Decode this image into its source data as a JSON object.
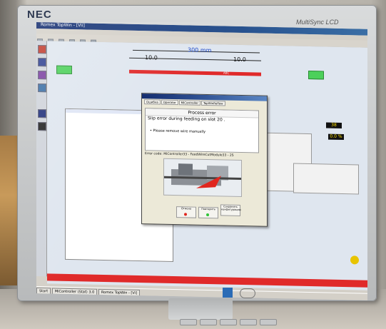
{
  "monitor": {
    "brand": "NEC",
    "model": "MultiSync LCD"
  },
  "app": {
    "title": "Romex TopWin - [Vii]"
  },
  "ruler": {
    "left_value": "10.0",
    "center_value": "300 mm",
    "right_value": "10.0",
    "tag": "ABC"
  },
  "dialog": {
    "tabs": [
      "Ошибка",
      "Operator",
      "MIController",
      "TopWinReflow"
    ],
    "header": "Process error",
    "message": "Slip error during feeding on slot 20 .",
    "bullet": "• Please remove wire manually",
    "error_code": "Error code: MiController33 - FeedWireCutModule33 - 25",
    "buttons": [
      "Отмена",
      "Повторить",
      "Сохранить конфигурацию"
    ]
  },
  "gauges": {
    "top": "38",
    "bottom": "0.0 %"
  },
  "taskbar": {
    "start": "Start",
    "items": [
      "MiController (Stat) 3.0",
      "Romex TopWin - [Vi]"
    ]
  },
  "colors": {
    "accent_red": "#e02a2a",
    "green": "#4cd05a",
    "titlebar": "#0a246a"
  }
}
